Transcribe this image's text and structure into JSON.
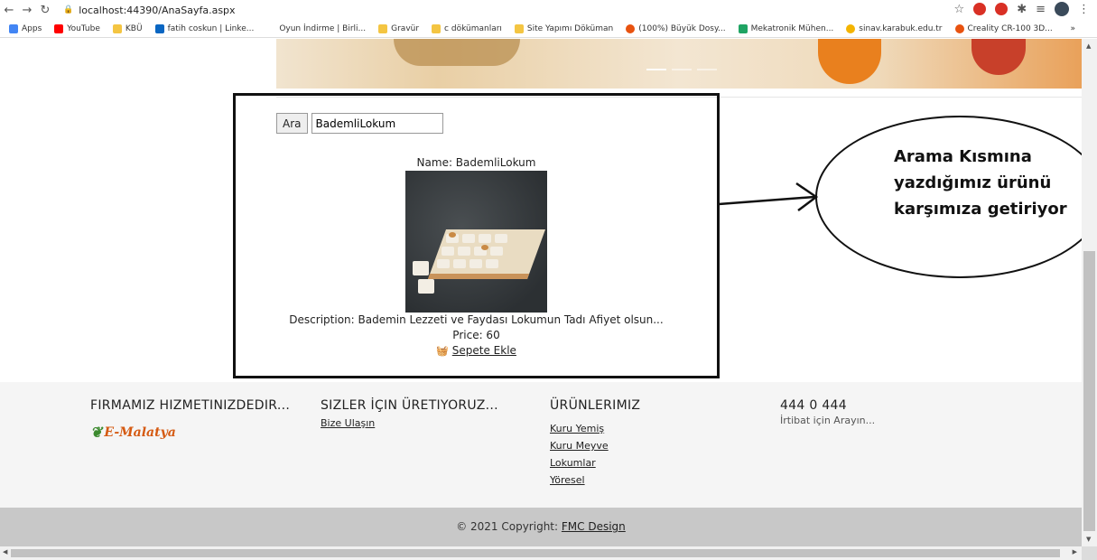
{
  "browser": {
    "url_host": "localhost:44390/AnaSayfa.aspx",
    "bookmarks": [
      {
        "label": "Apps",
        "color": "#4285f4"
      },
      {
        "label": "YouTube",
        "color": "#ff0000"
      },
      {
        "label": "KBÜ",
        "color": "#f4c542"
      },
      {
        "label": "fatih coskun | Linke...",
        "color": "#0a66c2"
      },
      {
        "label": "Oyun İndirme | Birli...",
        "color": "#ffffff"
      },
      {
        "label": "Gravür",
        "color": "#f4c542"
      },
      {
        "label": "c dökümanları",
        "color": "#f4c542"
      },
      {
        "label": "Site Yapımı Döküman",
        "color": "#f4c542"
      },
      {
        "label": "(100%) Büyük Dosy...",
        "color": "#e8520f"
      },
      {
        "label": "Mekatronik Mühen...",
        "color": "#1fa463"
      },
      {
        "label": "sinav.karabuk.edu.tr",
        "color": "#f4b400"
      },
      {
        "label": "Creality CR-100 3D...",
        "color": "#e8520f"
      }
    ],
    "more": "»"
  },
  "search": {
    "button_label": "Ara",
    "query": "BademliLokum"
  },
  "product": {
    "name_line": "Name: BademliLokum",
    "description_line": "Description: Bademin Lezzeti ve Faydası Lokumun Tadı Afiyet olsun...",
    "price_line": "Price: 60",
    "add_to_cart": "Sepete Ekle",
    "image_icon": "lokum-product-photo"
  },
  "annotation": {
    "line1": "Arama Kısmına",
    "line2": "yazdığımız ürünü",
    "line3": "karşımıza getiriyor"
  },
  "footer": {
    "col1": {
      "title": "FIRMAMIZ HIZMETINIZDEDIR...",
      "logo_text": "E-Malatya"
    },
    "col2": {
      "title": "SIZLER İÇIN ÜRETIYORUZ...",
      "link": "Bize Ulaşın"
    },
    "col3": {
      "title": "ÜRÜNLERIMIZ",
      "links": [
        "Kuru Yemiş",
        "Kuru Meyve",
        "Lokumlar",
        "Yöresel"
      ]
    },
    "col4": {
      "title": "444 0 444",
      "text": "İrtibat için Arayın..."
    }
  },
  "copyright": {
    "text": "© 2021 Copyright:",
    "link": "FMC Design"
  },
  "colors": {
    "footer_bg": "#f5f5f5",
    "copyright_bg": "#c8c8c8",
    "logo": "#d55a12"
  }
}
